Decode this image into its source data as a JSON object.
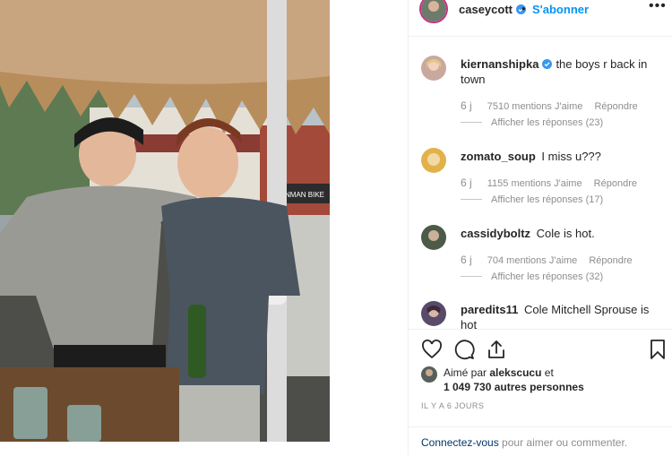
{
  "post": {
    "author": "caseycott",
    "follow_label": "S'abonner",
    "separator": "•",
    "more_icon": "more-options-icon"
  },
  "comments": [
    {
      "username": "kiernanshipka",
      "verified": true,
      "text": "the boys r back in town",
      "time": "6 j",
      "likes": "7510 mentions J'aime",
      "reply": "Répondre",
      "view_replies": "Afficher les réponses (23)"
    },
    {
      "username": "zomato_soup",
      "verified": false,
      "text": "I miss u???",
      "time": "6 j",
      "likes": "1155 mentions J'aime",
      "reply": "Répondre",
      "view_replies": "Afficher les réponses (17)"
    },
    {
      "username": "cassidyboltz",
      "verified": false,
      "text": "Cole is hot.",
      "time": "6 j",
      "likes": "704 mentions J'aime",
      "reply": "Répondre",
      "view_replies": "Afficher les réponses (32)"
    },
    {
      "username": "paredits11",
      "verified": false,
      "text": "Cole Mitchell Sprouse is hot",
      "time": "",
      "likes": "",
      "reply": "",
      "view_replies": ""
    }
  ],
  "actions": {
    "icons": [
      "heart-icon",
      "comment-icon",
      "share-icon",
      "bookmark-icon"
    ],
    "liked_prefix": "Aimé par",
    "liked_user": "alekscucu",
    "liked_suffix": "et",
    "liked_count": "1 049 730 autres personnes",
    "date": "IL Y A 6 JOURS"
  },
  "login": {
    "link": "Connectez-vous",
    "rest": " pour aimer ou commenter."
  },
  "colors": {
    "accent": "#0095f6",
    "text": "#262626",
    "muted": "#8e8e8e",
    "border": "#efefef"
  }
}
